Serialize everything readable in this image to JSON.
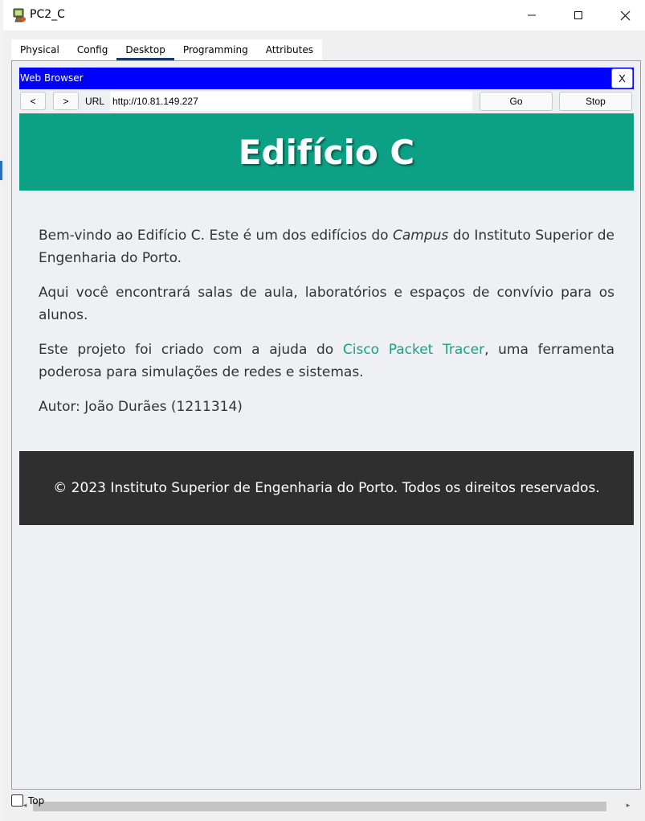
{
  "window": {
    "title": "PC2_C",
    "minimize_icon": "minimize-icon",
    "maximize_icon": "maximize-icon",
    "close_icon": "close-icon"
  },
  "tabs": [
    {
      "label": "Physical",
      "active": false
    },
    {
      "label": "Config",
      "active": false
    },
    {
      "label": "Desktop",
      "active": true
    },
    {
      "label": "Programming",
      "active": false
    },
    {
      "label": "Attributes",
      "active": false
    }
  ],
  "browser": {
    "title": "Web Browser",
    "close_label": "X",
    "back_label": "<",
    "forward_label": ">",
    "url_label": "URL",
    "url_value": "http://10.81.149.227",
    "go_label": "Go",
    "stop_label": "Stop"
  },
  "page": {
    "heading": "Edifício C",
    "p1_before": "Bem-vindo ao Edifício C. Este é um dos edifícios do ",
    "p1_em": "Campus",
    "p1_after": " do Instituto Superior de Engenharia do Porto.",
    "p2": "Aqui você encontrará salas de aula, laboratórios e espaços de convívio para os alunos.",
    "p3_before": "Este projeto foi criado com a ajuda do ",
    "p3_link": "Cisco Packet Tracer",
    "p3_after": ", uma ferramenta poderosa para simulações de redes e sistemas.",
    "author": "Autor: João Durães (1211314)",
    "footer": "© 2023 Instituto Superior de Engenharia do Porto. Todos os direitos reservados."
  },
  "bottom": {
    "top_label": "Top",
    "top_checked": false
  },
  "colors": {
    "browser_title_bg": "#0000ff",
    "hero_bg": "#0ca085",
    "link": "#1aa085",
    "footer_bg": "#2f2f2f",
    "active_tab_underline": "#1a3a6a"
  }
}
